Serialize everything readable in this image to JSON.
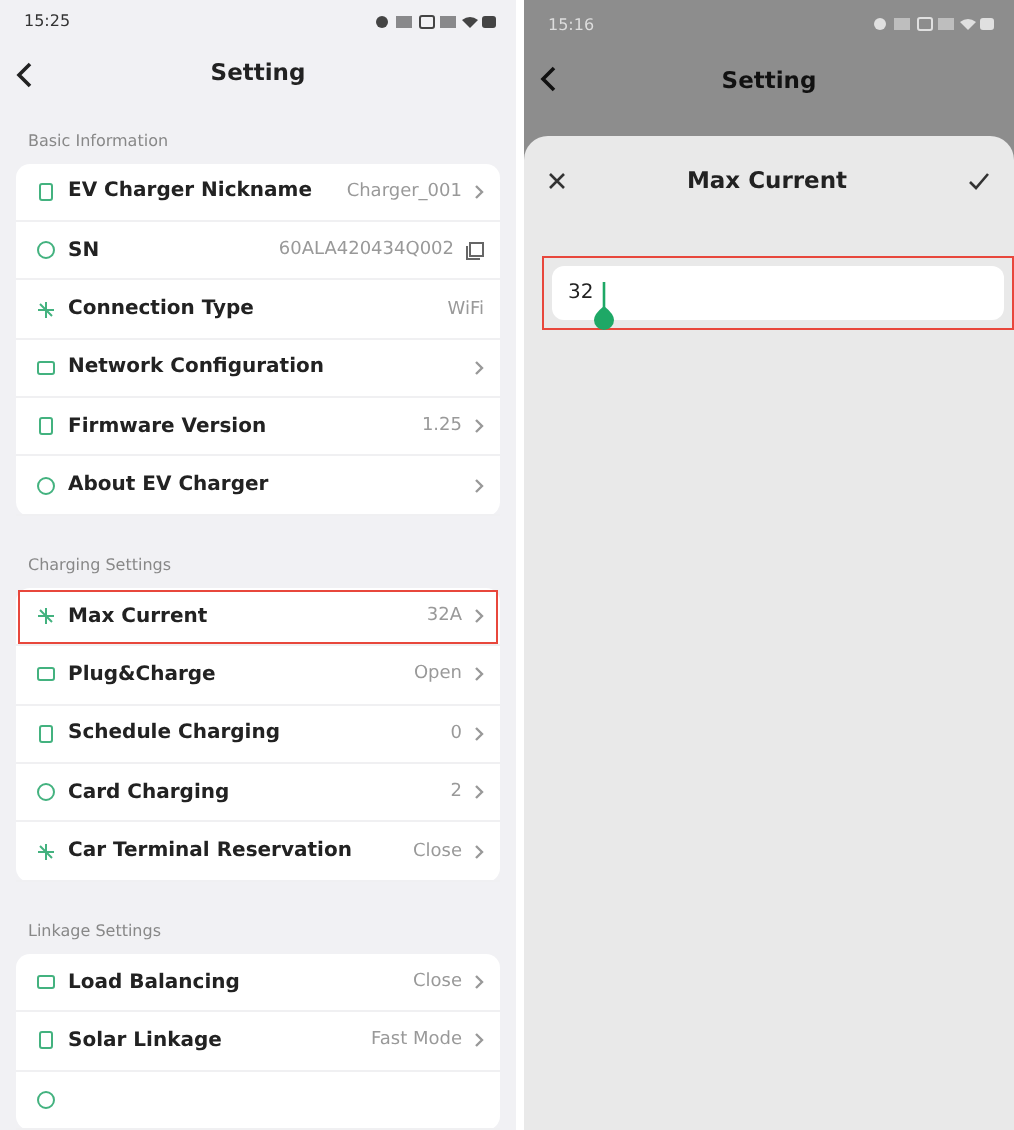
{
  "left_screen": {
    "status_bar": {
      "time": "15:25"
    },
    "header": {
      "title": "Setting"
    },
    "sections": [
      {
        "title": "Basic Information",
        "rows": [
          {
            "label": "EV Charger Nickname",
            "value": "Charger_001",
            "chevron": true,
            "copy": false,
            "highlighted": false
          },
          {
            "label": "SN",
            "value": "60ALA420434Q002",
            "chevron": false,
            "copy": true,
            "highlighted": false
          },
          {
            "label": "Connection Type",
            "value": "WiFi",
            "chevron": false,
            "copy": false,
            "highlighted": false
          },
          {
            "label": "Network Configuration",
            "chevron": true,
            "copy": false,
            "highlighted": false
          },
          {
            "label": "Firmware Version",
            "value": "1.25",
            "chevron": true,
            "copy": false,
            "highlighted": false
          },
          {
            "label": "About EV Charger",
            "chevron": true,
            "copy": false,
            "highlighted": false
          }
        ]
      },
      {
        "title": "Charging Settings",
        "rows": [
          {
            "label": "Max Current",
            "value": "32A",
            "chevron": true,
            "copy": false,
            "highlighted": true
          },
          {
            "label": "Plug&Charge",
            "value": "Open",
            "chevron": true,
            "copy": false,
            "highlighted": false
          },
          {
            "label": "Schedule Charging",
            "value": "0",
            "chevron": true,
            "copy": false,
            "highlighted": false
          },
          {
            "label": "Card Charging",
            "value": "2",
            "chevron": true,
            "copy": false,
            "highlighted": false
          },
          {
            "label": "Car Terminal Reservation",
            "value": "Close",
            "chevron": true,
            "copy": false,
            "highlighted": false
          }
        ]
      },
      {
        "title": "Linkage Settings",
        "rows": [
          {
            "label": "Load Balancing",
            "value": "Close",
            "chevron": true,
            "copy": false,
            "highlighted": false
          },
          {
            "label": "Solar Linkage",
            "value": "Fast Mode",
            "chevron": true,
            "copy": false,
            "highlighted": false
          }
        ]
      }
    ]
  },
  "right_screen": {
    "status_bar": {
      "time": "15:16"
    },
    "header": {
      "title": "Setting"
    },
    "sheet": {
      "title": "Max Current",
      "field": {
        "value": "32",
        "highlighted": true
      }
    }
  }
}
